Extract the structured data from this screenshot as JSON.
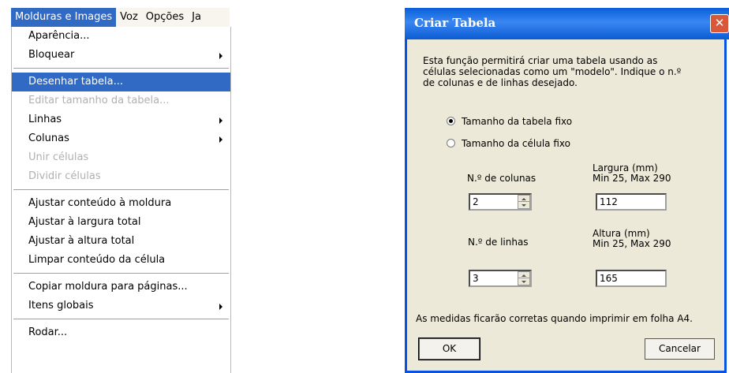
{
  "menubar": {
    "items": [
      "Molduras e Images",
      "Voz",
      "Opções",
      "Ja"
    ],
    "active_index": 0
  },
  "menu": {
    "items": [
      {
        "label": "Aparência...",
        "enabled": true,
        "submenu": false
      },
      {
        "label": "Bloquear",
        "enabled": true,
        "submenu": true
      },
      {
        "separator": true
      },
      {
        "label": "Desenhar tabela...",
        "enabled": true,
        "submenu": false,
        "highlighted": true
      },
      {
        "label": "Editar tamanho da tabela...",
        "enabled": false,
        "submenu": false
      },
      {
        "label": "Linhas",
        "enabled": true,
        "submenu": true
      },
      {
        "label": "Colunas",
        "enabled": true,
        "submenu": true
      },
      {
        "label": "Unir células",
        "enabled": false,
        "submenu": false
      },
      {
        "label": "Dividir células",
        "enabled": false,
        "submenu": false
      },
      {
        "separator": true
      },
      {
        "label": "Ajustar conteúdo à moldura",
        "enabled": true,
        "submenu": false
      },
      {
        "label": "Ajustar à largura total",
        "enabled": true,
        "submenu": false
      },
      {
        "label": "Ajustar à altura total",
        "enabled": true,
        "submenu": false
      },
      {
        "label": "Limpar conteúdo da célula",
        "enabled": true,
        "submenu": false
      },
      {
        "separator": true
      },
      {
        "label": "Copiar moldura para páginas...",
        "enabled": true,
        "submenu": false
      },
      {
        "label": "Itens globais",
        "enabled": true,
        "submenu": true
      },
      {
        "separator": true
      },
      {
        "label": "Rodar...",
        "enabled": true,
        "submenu": false
      }
    ]
  },
  "dialog": {
    "title": "Criar Tabela",
    "close_glyph": "✕",
    "description": [
      "Esta função permitirá criar uma tabela usando as",
      "células selecionadas como um \"modelo\". Indique o n.º",
      "de colunas e de linhas desejado."
    ],
    "radio_fixed_table": "Tamanho da tabela fixo",
    "radio_fixed_cell": "Tamanho da célula fixo",
    "selected_radio": "fixed_table",
    "columns_label": "N.º de colunas",
    "columns_value": "2",
    "width_label": "Largura (mm)",
    "width_range": "Min 25, Max 290",
    "width_value": "112",
    "rows_label": "N.º de linhas",
    "rows_value": "3",
    "height_label": "Altura (mm)",
    "height_range": "Min 25, Max 290",
    "height_value": "165",
    "footer_note": "As medidas ficarão corretas quando imprimir em folha A4.",
    "ok_label": "OK",
    "cancel_label": "Cancelar"
  },
  "colors": {
    "highlight": "#316ac5",
    "titlebar": "#0a5fd8",
    "dialog_bg": "#ece9d8",
    "disabled_text": "#b0b0b0"
  }
}
